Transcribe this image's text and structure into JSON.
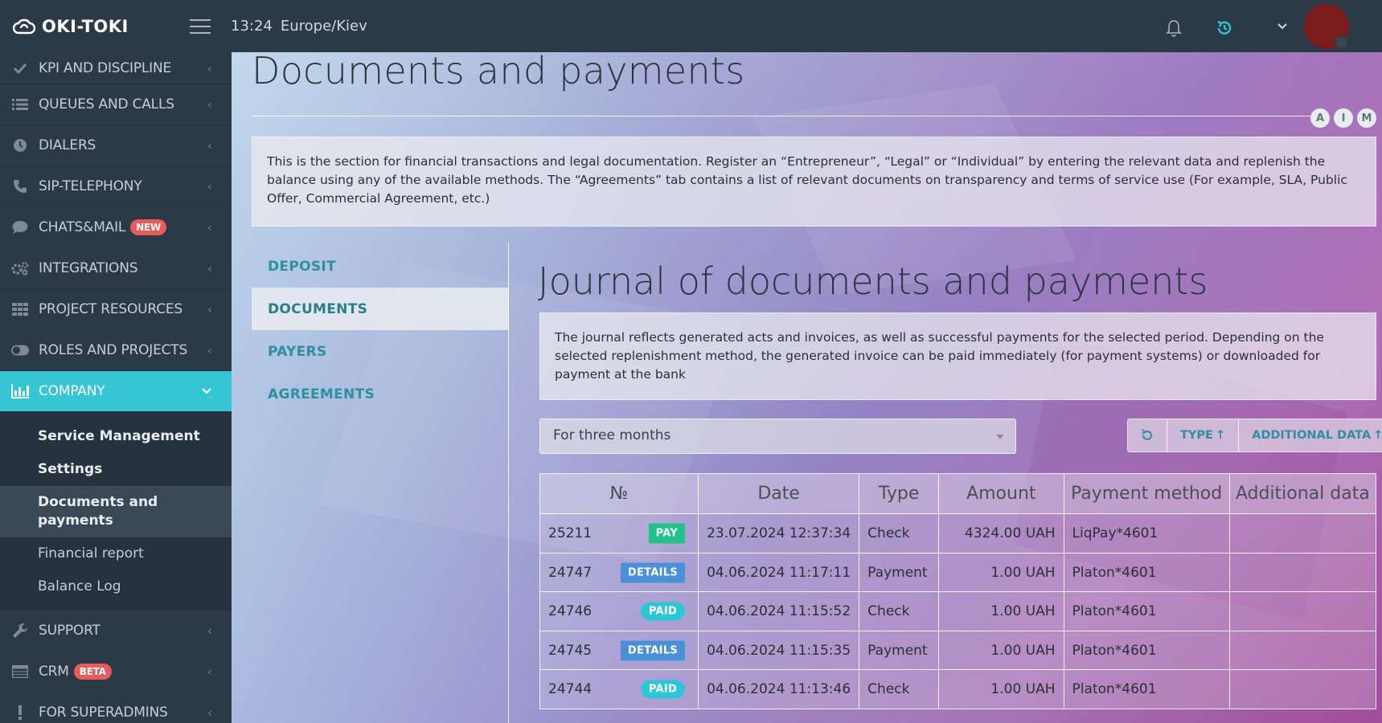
{
  "header": {
    "logo": "OKI-TOKI",
    "time": "13:24",
    "timezone": "Europe/Kiev"
  },
  "sidebar": {
    "items": [
      {
        "label": "KPI AND DISCIPLINE",
        "icon": "check-icon"
      },
      {
        "label": "QUEUES AND CALLS",
        "icon": "list-icon"
      },
      {
        "label": "DIALERS",
        "icon": "clock-icon"
      },
      {
        "label": "SIP-TELEPHONY",
        "icon": "phone-icon"
      },
      {
        "label": "CHATS&MAIL",
        "icon": "chat-icon",
        "badge": "NEW"
      },
      {
        "label": "INTEGRATIONS",
        "icon": "gears-icon"
      },
      {
        "label": "PROJECT RESOURCES",
        "icon": "grid-icon"
      },
      {
        "label": "ROLES AND PROJECTS",
        "icon": "toggle-icon"
      }
    ],
    "active": {
      "label": "COMPANY",
      "icon": "bar-chart-icon"
    },
    "submenu": [
      "Service Management",
      "Settings",
      "Documents and payments",
      "Financial report",
      "Balance Log"
    ],
    "bottom_items": [
      {
        "label": "SUPPORT",
        "icon": "wrench-icon"
      },
      {
        "label": "CRM",
        "icon": "table-icon",
        "badge": "BETA"
      },
      {
        "label": "FOR SUPERADMINS",
        "icon": "exclamation-icon"
      }
    ]
  },
  "page": {
    "title": "Documents and payments",
    "aim": [
      "A",
      "I",
      "M"
    ],
    "info": "This is the section for financial transactions and legal documentation. Register an “Entrepreneur”, “Legal” or “Individual” by entering the relevant data and replenish the balance using any of the available methods. The “Agreements” tab contains a list of relevant documents on transparency and terms of service use (For example, SLA, Public Offer, Commercial Agreement, etc.)"
  },
  "tabs": [
    "DEPOSIT",
    "DOCUMENTS",
    "PAYERS",
    "AGREEMENTS"
  ],
  "journal": {
    "title": "Journal of documents and payments",
    "info": "The journal reflects generated acts and invoices, as well as successful payments for the selected period. Depending on the selected replenishment method, the generated invoice can be paid immediately (for payment systems) or downloaded for payment at the bank",
    "period": "For three months",
    "buttons": {
      "type": "TYPE",
      "additional": "ADDITIONAL DATA"
    },
    "columns": [
      "№",
      "Date",
      "Type",
      "Amount",
      "Payment method",
      "Additional data"
    ],
    "rows": [
      {
        "num": "25211",
        "action": "PAY",
        "date": "23.07.2024 12:37:34",
        "type": "Check",
        "amount": "4324.00 UAH",
        "method": "LiqPay*4601",
        "extra": ""
      },
      {
        "num": "24747",
        "action": "DETAILS",
        "date": "04.06.2024 11:17:11",
        "type": "Payment",
        "amount": "1.00 UAH",
        "method": "Platon*4601",
        "extra": ""
      },
      {
        "num": "24746",
        "action": "PAID",
        "date": "04.06.2024 11:15:52",
        "type": "Check",
        "amount": "1.00 UAH",
        "method": "Platon*4601",
        "extra": ""
      },
      {
        "num": "24745",
        "action": "DETAILS",
        "date": "04.06.2024 11:15:35",
        "type": "Payment",
        "amount": "1.00 UAH",
        "method": "Platon*4601",
        "extra": ""
      },
      {
        "num": "24744",
        "action": "PAID",
        "date": "04.06.2024 11:13:46",
        "type": "Check",
        "amount": "1.00 UAH",
        "method": "Platon*4601",
        "extra": ""
      }
    ]
  },
  "colors": {
    "accent": "#35c5d4",
    "sidebar": "#2c3a47",
    "link": "#2e8fa0",
    "pay": "#22c08a",
    "details": "#4a90d9",
    "paid": "#2cc7d6",
    "badge": "#e95a5a"
  }
}
